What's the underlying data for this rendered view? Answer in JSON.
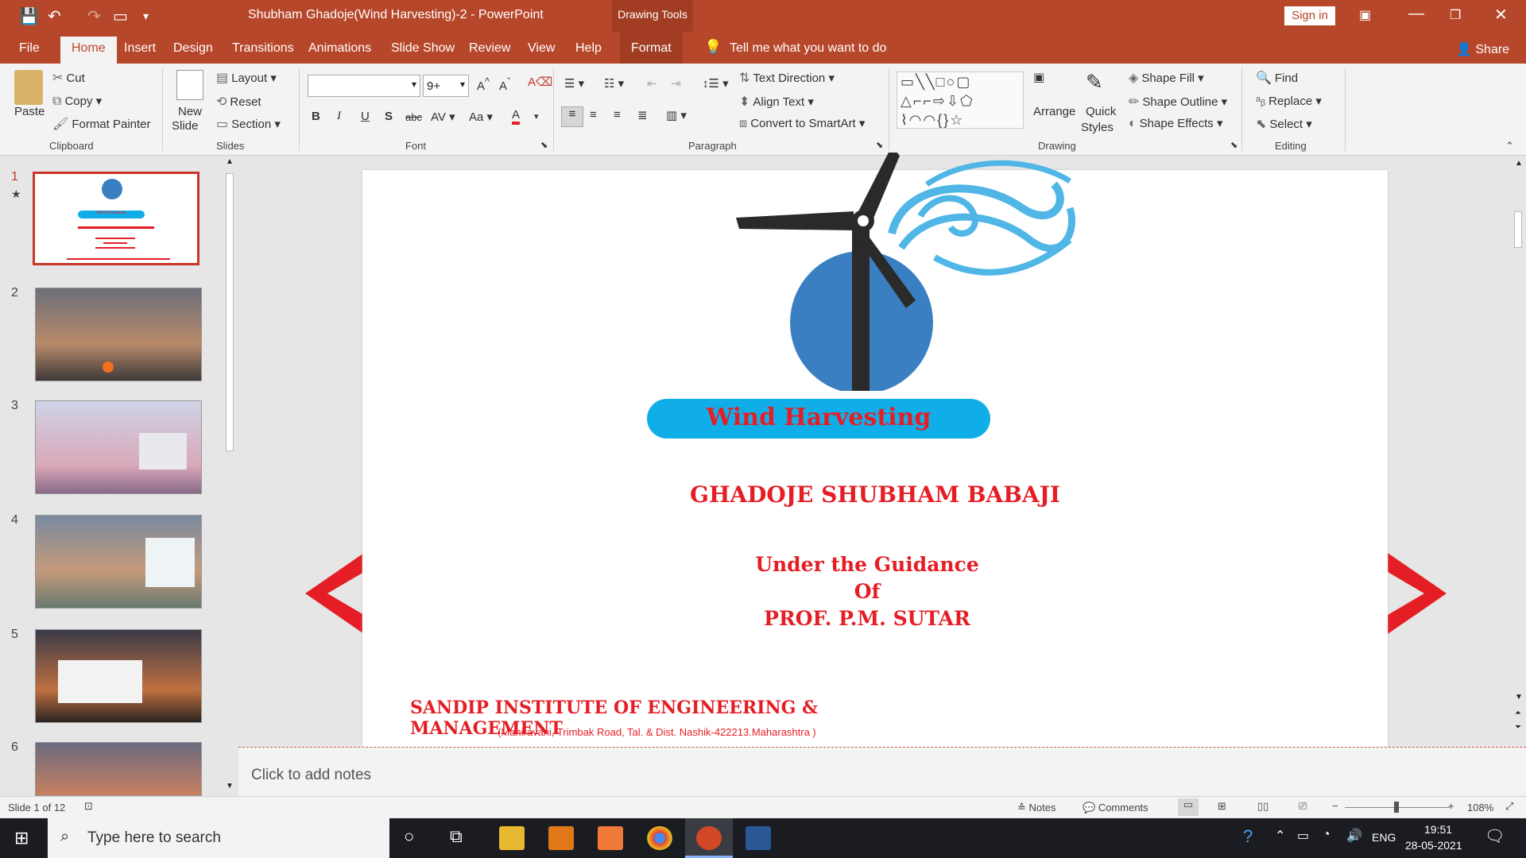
{
  "window": {
    "title": "Shubham Ghadoje(Wind Harvesting)-2  -  PowerPoint",
    "context_tab": "Drawing Tools",
    "sign_in": "Sign in"
  },
  "menu": {
    "file": "File",
    "home": "Home",
    "insert": "Insert",
    "design": "Design",
    "transitions": "Transitions",
    "animations": "Animations",
    "slideshow": "Slide Show",
    "review": "Review",
    "view": "View",
    "help": "Help",
    "format": "Format",
    "tell_me": "Tell me what you want to do",
    "share": "Share"
  },
  "ribbon": {
    "clipboard": {
      "paste": "Paste",
      "cut": "Cut",
      "copy": "Copy",
      "format_painter": "Format Painter",
      "label": "Clipboard"
    },
    "slides": {
      "new_slide_1": "New",
      "new_slide_2": "Slide",
      "layout": "Layout",
      "reset": "Reset",
      "section": "Section",
      "label": "Slides"
    },
    "font": {
      "size": "9+",
      "label": "Font"
    },
    "paragraph": {
      "text_direction": "Text Direction",
      "align_text": "Align Text",
      "convert_smartart": "Convert to SmartArt",
      "label": "Paragraph"
    },
    "drawing": {
      "arrange": "Arrange",
      "quick_styles_1": "Quick",
      "quick_styles_2": "Styles",
      "shape_fill": "Shape Fill",
      "shape_outline": "Shape Outline",
      "shape_effects": "Shape Effects",
      "label": "Drawing"
    },
    "editing": {
      "find": "Find",
      "replace": "Replace",
      "select": "Select",
      "label": "Editing"
    }
  },
  "thumbnails": [
    {
      "num": "1",
      "title": "Wind Harvesting"
    },
    {
      "num": "2"
    },
    {
      "num": "3"
    },
    {
      "num": "4"
    },
    {
      "num": "5"
    },
    {
      "num": "6"
    }
  ],
  "slide": {
    "banner": "Wind Harvesting",
    "author": "GHADOJE SHUBHAM BABAJI",
    "guidance_1": "Under the Guidance",
    "guidance_2": "Of",
    "guidance_3": "PROF. P.M. SUTAR",
    "institute": "SANDIP INSTITUTE OF ENGINEERING & MANAGEMENT",
    "address": "(Mahiravani, Trimbak Road, Tal. & Dist. Nashik-422213.Maharashtra  )"
  },
  "notes": {
    "placeholder": "Click to add notes"
  },
  "status": {
    "slide_info": "Slide 1 of 12",
    "notes": "Notes",
    "comments": "Comments",
    "zoom": "108%"
  },
  "taskbar": {
    "search_placeholder": "Type here to search",
    "lang": "ENG",
    "time": "19:51",
    "date": "28-05-2021"
  },
  "colors": {
    "accent": "#b7472a",
    "slide_red": "#e51e25",
    "banner_blue": "#10aee8"
  }
}
